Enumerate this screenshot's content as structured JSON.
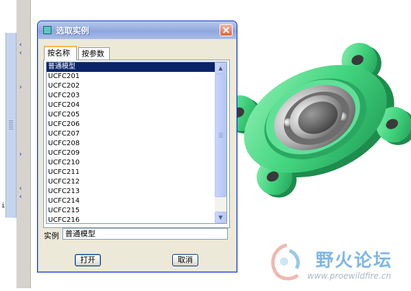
{
  "dialog": {
    "title": "选取实例",
    "tabs": [
      {
        "label": "按名称",
        "active": true
      },
      {
        "label": "按参数",
        "active": false
      }
    ],
    "list_items": [
      "普通模型",
      "UCFC201",
      "UCFC202",
      "UCFC203",
      "UCFC204",
      "UCFC205",
      "UCFC206",
      "UCFC207",
      "UCFC208",
      "UCFC209",
      "UCFC210",
      "UCFC211",
      "UCFC212",
      "UCFC213",
      "UCFC214",
      "UCFC215",
      "UCFC216"
    ],
    "selected_index": 0,
    "instance_label": "实例",
    "instance_value": "普通模型",
    "open_label": "打开",
    "cancel_label": "取消"
  },
  "left_strip_text": "i",
  "watermark": {
    "name": "野火论坛",
    "url": "www.proewildfire.cn"
  },
  "colors": {
    "flange": "#3fd17a",
    "selection": "#0a246a",
    "titlebar": "#8fa7dd"
  }
}
